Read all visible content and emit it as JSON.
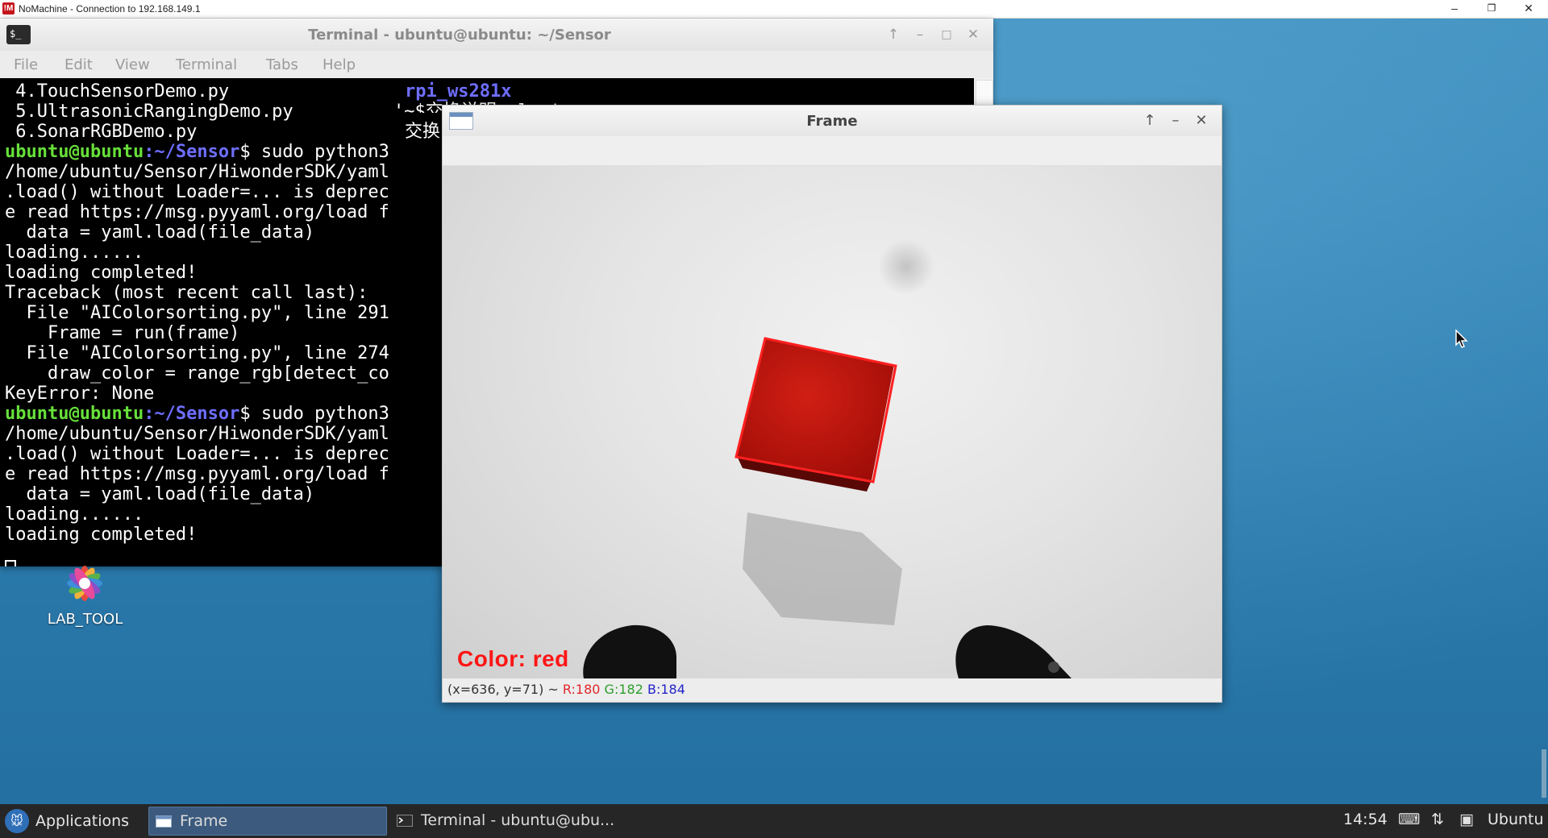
{
  "host": {
    "title": "NoMachine - Connection to 192.168.149.1",
    "logo": "!M",
    "minimize": "–",
    "restore": "❐",
    "close": "✕"
  },
  "terminal": {
    "title": "Terminal - ubuntu@ubuntu: ~/Sensor",
    "menu": [
      "File",
      "Edit",
      "View",
      "Terminal",
      "Tabs",
      "Help"
    ],
    "lines": [
      {
        "text": " 4.TouchSensorDemo.py"
      },
      {
        "text": " 5.UltrasonicRangingDemo.py"
      },
      {
        "text": " 6.SonarRGBDemo.py"
      },
      {
        "prompt_user": "ubuntu@ubuntu",
        "prompt_path": ":~/Sensor",
        "text": "$ sudo python3"
      },
      {
        "text": "/home/ubuntu/Sensor/HiwonderSDK/yaml"
      },
      {
        "text": ".load() without Loader=... is deprec"
      },
      {
        "text": "e read https://msg.pyyaml.org/load f"
      },
      {
        "text": "  data = yaml.load(file_data)"
      },
      {
        "text": "loading......"
      },
      {
        "text": "loading completed!"
      },
      {
        "text": "Traceback (most recent call last):"
      },
      {
        "text": "  File \"AIColorsorting.py\", line 291"
      },
      {
        "text": "    Frame = run(frame)"
      },
      {
        "text": "  File \"AIColorsorting.py\", line 274"
      },
      {
        "text": "    draw_color = range_rgb[detect_co"
      },
      {
        "text": "KeyError: None"
      },
      {
        "prompt_user": "ubuntu@ubuntu",
        "prompt_path": ":~/Sensor",
        "text": "$ sudo python3"
      },
      {
        "text": "/home/ubuntu/Sensor/HiwonderSDK/yaml"
      },
      {
        "text": ".load() without Loader=... is deprec"
      },
      {
        "text": "e read https://msg.pyyaml.org/load f"
      },
      {
        "text": "  data = yaml.load(file_data)"
      },
      {
        "text": "loading......"
      },
      {
        "text": "loading completed!"
      }
    ],
    "right_col": {
      "line1": "rpi_ws281x",
      "line2": "'~$交换说明.xlsx'",
      "line3": "交换"
    }
  },
  "desktop_icon": {
    "label": "LAB_TOOL"
  },
  "frame": {
    "title": "Frame",
    "color_label": "Color: red",
    "status_coords": "(x=636, y=71) ~ ",
    "status_r": "R:180",
    "status_g": "G:182",
    "status_b": "B:184"
  },
  "taskbar": {
    "applications": "Applications",
    "tasks": [
      {
        "label": "Frame",
        "active": true
      },
      {
        "label": "Terminal - ubuntu@ubu...",
        "active": false
      }
    ],
    "clock": "14:54",
    "user": "Ubuntu"
  },
  "colors": {
    "prompt_user": "#67e03a",
    "prompt_path": "#6e6eff",
    "detected_box": "#ff2020",
    "taskbar_active": "#3b5a7d"
  }
}
